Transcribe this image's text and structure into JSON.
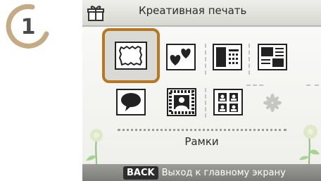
{
  "step": {
    "number": "1"
  },
  "header": {
    "icon": "gift-icon",
    "title": "Креативная печать"
  },
  "menu": {
    "items": [
      {
        "icon": "stamp-frame-icon",
        "selected": true
      },
      {
        "icon": "hearts-icon",
        "selected": false
      },
      {
        "icon": "photo-calendar-icon",
        "selected": false
      },
      {
        "icon": "photo-layout-icon",
        "selected": false
      },
      {
        "icon": "speech-bubble-icon",
        "selected": false
      },
      {
        "icon": "portrait-frame-icon",
        "selected": false
      },
      {
        "icon": "id-photo-icon",
        "selected": false
      },
      {
        "icon": "sparkle-icon",
        "selected": false
      }
    ],
    "selected_label": "Рамки"
  },
  "footer": {
    "back_key": "BACK",
    "back_text": "Выход к главному экрану"
  },
  "colors": {
    "selection_border": "#b87722",
    "footer_bg": "#8a8a87",
    "text": "#2b2b2b"
  }
}
